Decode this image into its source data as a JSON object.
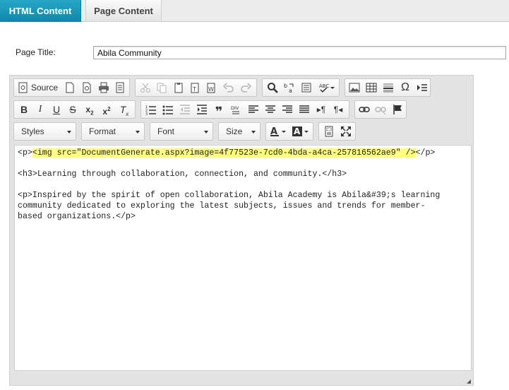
{
  "tabs": [
    {
      "label": "HTML Content",
      "active": true
    },
    {
      "label": "Page Content",
      "active": false
    }
  ],
  "page_title": {
    "label": "Page Title:",
    "value": "Abila Community"
  },
  "toolbar": {
    "source_label": "Source",
    "combos": {
      "styles": "Styles",
      "format": "Format",
      "font": "Font",
      "size": "Size"
    }
  },
  "code": {
    "line1_open": "<p>",
    "line1_highlight": "<img src=\"DocumentGenerate.aspx?image=4f77523e-7cd0-4bda-a4ca-257816562ae9\" />",
    "line1_close": "</p>",
    "line2": "<h3>Learning through collaboration, connection, and community.</h3>",
    "line3": "<p>Inspired by the spirit of open collaboration, Abila Academy is Abila&#39;s learning",
    "line4": "community dedicated to exploring the latest subjects, issues and trends for member-",
    "line5": "based organizations.</p>"
  },
  "colors": {
    "active_tab": "#1a97b8",
    "highlight": "#ffff7a"
  }
}
